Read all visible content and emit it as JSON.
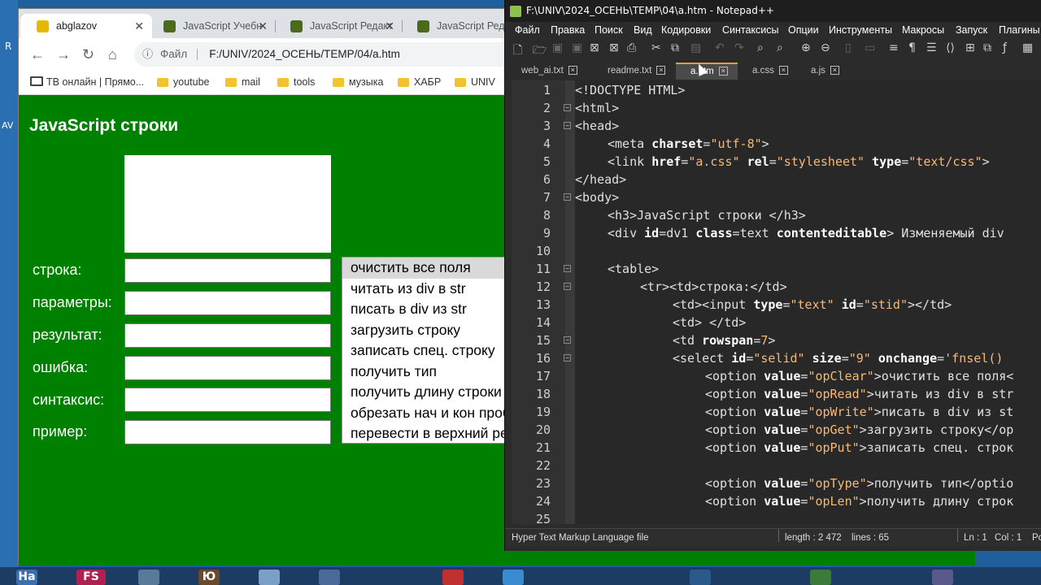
{
  "desktop": {
    "left_letters": [
      "R",
      "AV"
    ]
  },
  "browser": {
    "tabs": [
      {
        "title": "abglazov",
        "active": true
      },
      {
        "title": "JavaScript Учебн",
        "active": false
      },
      {
        "title": "JavaScript Редакт",
        "active": false
      },
      {
        "title": "JavaScript Редакт",
        "active": false
      }
    ],
    "address": {
      "scheme_label": "Файл",
      "url": "F:/UNIV/2024_ОСЕНЬ/TEMP/04/a.htm"
    },
    "bookmarks": [
      {
        "label": "ТВ онлайн | Прямо..."
      },
      {
        "label": "youtube"
      },
      {
        "label": "mail"
      },
      {
        "label": "tools"
      },
      {
        "label": "музыка"
      },
      {
        "label": "ХАБР"
      },
      {
        "label": "UNIV"
      }
    ]
  },
  "page": {
    "heading": "JavaScript строки",
    "rows": [
      {
        "label": "строка:"
      },
      {
        "label": "параметры:"
      },
      {
        "label": "результат:"
      },
      {
        "label": "ошибка:"
      },
      {
        "label": "синтаксис:"
      },
      {
        "label": "пример:"
      }
    ],
    "options": [
      "очистить все поля",
      "читать из div в str",
      "писать в div из str",
      "загрузить строку",
      "записать спец. строку",
      "получить тип",
      "получить длину строки",
      "обрезать нач и кон пробелы",
      "перевести в верхний регистр"
    ]
  },
  "notepad": {
    "title": "F:\\UNIV\\2024_ОСЕНЬ\\TEMP\\04\\a.htm - Notepad++",
    "menu": [
      "Файл",
      "Правка",
      "Поиск",
      "Вид",
      "Кодировки",
      "Синтаксисы",
      "Опции",
      "Инструменты",
      "Макросы",
      "Запуск",
      "Плагины"
    ],
    "tabs": [
      "web_ai.txt",
      "readme.txt",
      "a.htm",
      "a.css",
      "a.js"
    ],
    "active_tab": "a.htm",
    "lines": [
      {
        "n": "1"
      },
      {
        "n": "2"
      },
      {
        "n": "3"
      },
      {
        "n": "4"
      },
      {
        "n": "5"
      },
      {
        "n": "6"
      },
      {
        "n": "7"
      },
      {
        "n": "8"
      },
      {
        "n": "9"
      },
      {
        "n": "10"
      },
      {
        "n": "11"
      },
      {
        "n": "12"
      },
      {
        "n": "13"
      },
      {
        "n": "14"
      },
      {
        "n": "15"
      },
      {
        "n": "16"
      },
      {
        "n": "17"
      },
      {
        "n": "18"
      },
      {
        "n": "19"
      },
      {
        "n": "20"
      },
      {
        "n": "21"
      },
      {
        "n": "22"
      },
      {
        "n": "23"
      },
      {
        "n": "24"
      },
      {
        "n": "25"
      }
    ],
    "code": {
      "l1": "<!DOCTYPE HTML>",
      "l2": "<html>",
      "l3": "<head>",
      "l4_tag": "<meta ",
      "l4_attr": "charset",
      "l4_eq": "=",
      "l4_val": "\"utf-8\"",
      "l4_end": ">",
      "l5_tag": "<link ",
      "l5_a1": "href",
      "l5_v1": "\"a.css\"",
      "l5_a2": "rel",
      "l5_v2": "\"stylesheet\"",
      "l5_a3": "type",
      "l5_v3": "\"text/css\"",
      "l5_end": ">",
      "l6": "</head>",
      "l7": "<body>",
      "l8": "<h3>JavaScript строки </h3>",
      "l10_tag": "<div ",
      "l10_a1": "id",
      "l10_v1": "dv1",
      "l10_a2": "class",
      "l10_v2": "text",
      "l10_a3": "contenteditable",
      "l10_end": "> Изменяемый div",
      "l11": "<table>",
      "l12": "<tr><td>строка:</td>",
      "l13_tag": "<td><input ",
      "l13_a1": "type",
      "l13_v1": "\"text\"",
      "l13_a2": "id",
      "l13_v2": "\"stid\"",
      "l13_end": "></td>",
      "l14": "<td> </td>",
      "l15_tag": "<td ",
      "l15_a1": "rowspan",
      "l15_v1": "7",
      "l15_end": ">",
      "l16_tag": "<select ",
      "l16_a1": "id",
      "l16_v1": "\"selid\"",
      "l16_a2": "size",
      "l16_v2": "\"9\"",
      "l16_a3": "onchange",
      "l16_v3": "'fnsel()",
      "opt_tag": "<option ",
      "opt_attr": "value",
      "l17_v": "\"opClear\"",
      "l17_t": ">очистить все поля<",
      "l18_v": "\"opRead\"",
      "l18_t": ">читать из div в str",
      "l19_v": "\"opWrite\"",
      "l19_t": ">писать в div из st",
      "l20_v": "\"opGet\"",
      "l20_t": ">загрузить строку</op",
      "l21_v": "\"opPut\"",
      "l21_t": ">записать спец. строк",
      "l23_v": "\"opType\"",
      "l23_t": ">получить тип</optio",
      "l24_v": "\"opLen\"",
      "l24_t": ">получить длину строк"
    },
    "status": {
      "filetype": "Hyper Text Markup Language file",
      "length": "length : 2 472",
      "lines": "lines : 65",
      "ln": "Ln : 1",
      "col": "Col : 1",
      "pos": "Po"
    }
  },
  "taskbar": {
    "icons": [
      "Ha",
      "FS",
      "Ю"
    ]
  }
}
